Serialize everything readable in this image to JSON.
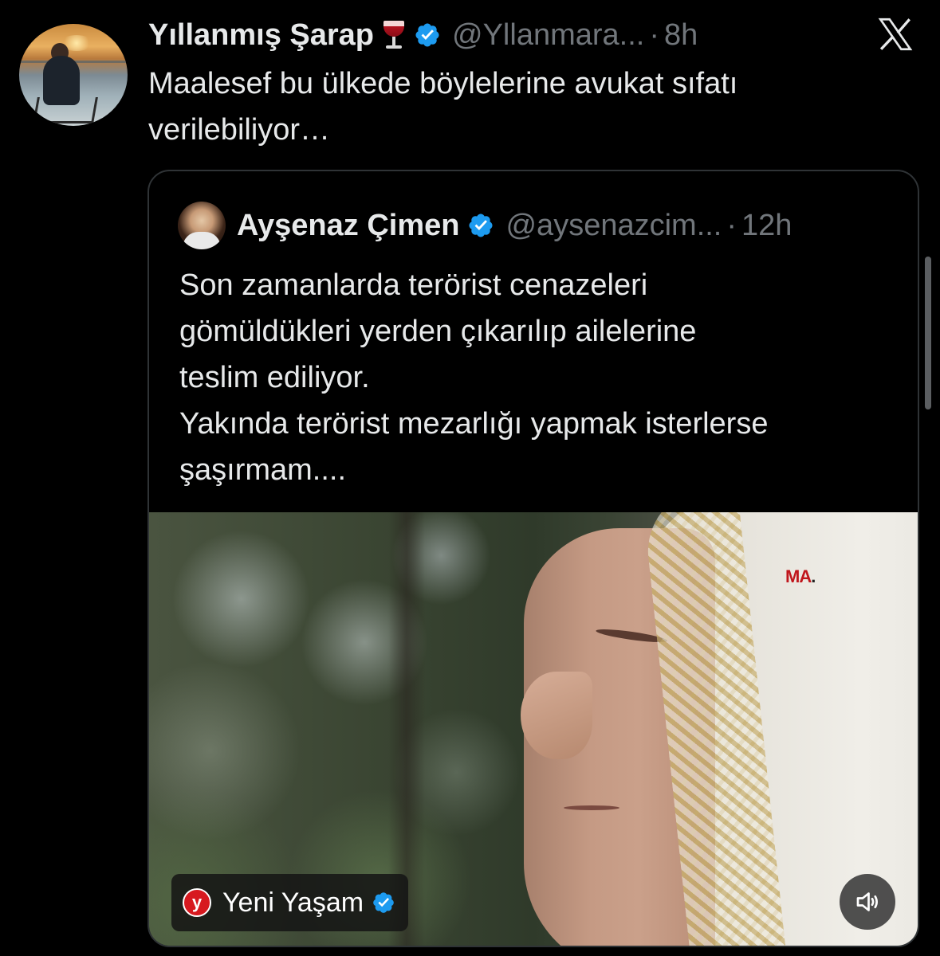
{
  "tweet": {
    "author_name": "Yıllanmış Şarap",
    "author_emoji": "wine-glass-icon",
    "handle": "@Yllanmara...",
    "separator": "·",
    "time": "8h",
    "text_line1": "Maalesef bu ülkede böylelerine avukat sıfatı",
    "text_line2": "verilebiliyor…"
  },
  "quoted": {
    "author_name": "Ayşenaz Çimen",
    "handle": "@aysenazcim...",
    "separator": "·",
    "time": "12h",
    "text_lines": [
      "Son zamanlarda terörist cenazeleri",
      "gömüldükleri yerden çıkarılıp ailelerine",
      "teslim ediliyor.",
      "Yakında terörist mezarlığı yapmak isterlerse",
      "şaşırmam...."
    ],
    "media": {
      "source_name": "Yeni Yaşam",
      "source_logo_letter": "y",
      "watermark_red": "MA",
      "watermark_dark": ".",
      "volume_icon": "speaker-icon"
    }
  },
  "colors": {
    "background": "#000000",
    "text_primary": "#e7e9ea",
    "text_secondary": "#71767b",
    "verified_blue": "#1d9bf0",
    "card_border": "#2f3336"
  }
}
